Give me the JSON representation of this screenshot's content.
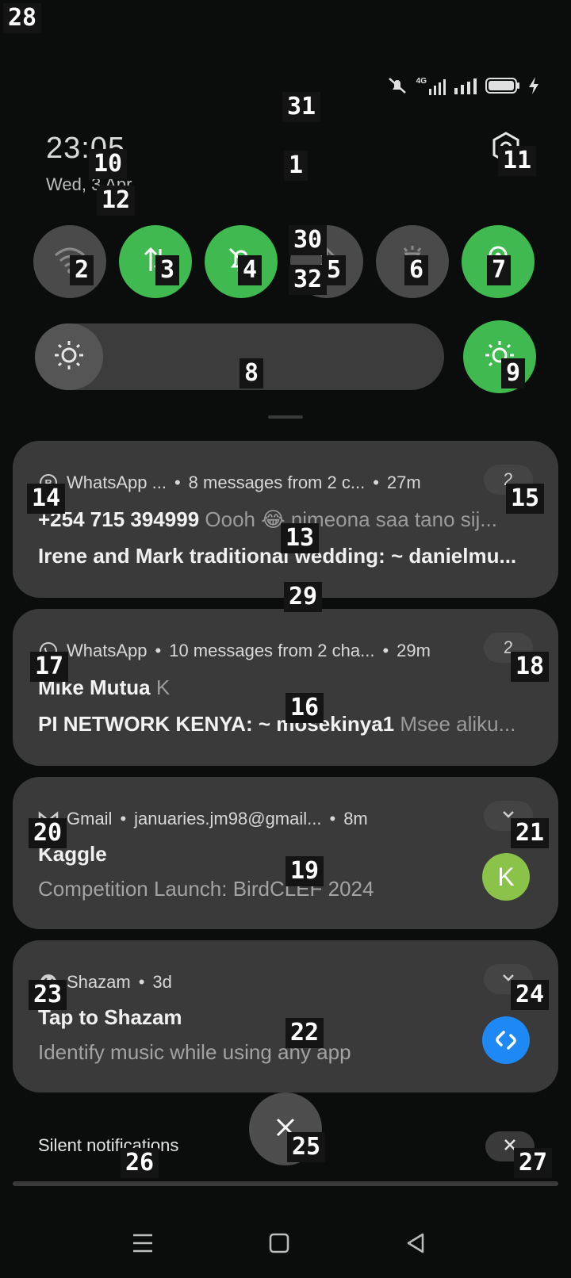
{
  "status_bar": {
    "network": "4G",
    "icons": [
      "muted-bell-icon",
      "signal-4g-icon",
      "signal-icon",
      "battery-icon",
      "charging-icon"
    ]
  },
  "header": {
    "time": "23:05",
    "date": "Wed, 3 Apr"
  },
  "quick_settings": {
    "tiles": [
      {
        "name": "wifi",
        "icon": "wifi-icon",
        "active": false
      },
      {
        "name": "mobile-data",
        "icon": "data-arrows-icon",
        "active": true
      },
      {
        "name": "silent",
        "icon": "bell-off-icon",
        "active": true
      },
      {
        "name": "bluetooth",
        "icon": "bluetooth-icon",
        "active": false
      },
      {
        "name": "flashlight",
        "icon": "flashlight-icon",
        "active": false
      },
      {
        "name": "location",
        "icon": "location-icon",
        "active": true
      }
    ],
    "brightness_level": 0.15,
    "auto_brightness": true
  },
  "notifications": [
    {
      "app": "WhatsApp ...",
      "summary": "8 messages from 2 c...",
      "time": "27m",
      "count": "2",
      "sender": "+254 715 394999",
      "preview": "Oooh 😂 nimeona saa tano sij...",
      "line2_title": "Irene and Mark traditional wedding: ~ danielmu...",
      "line2_body": ""
    },
    {
      "app": "WhatsApp",
      "summary": "10 messages from 2 cha...",
      "time": "29m",
      "count": "2",
      "sender": "Mike Mutua",
      "preview": "K",
      "line2_title": "PI NETWORK KENYA: ~ mosekinya1",
      "line2_body": "Msee aliku..."
    },
    {
      "app": "Gmail",
      "summary": "januaries.jm98@gmail...",
      "time": "8m",
      "title": "Kaggle",
      "body": "Competition Launch: BirdCLEF 2024",
      "avatar_letter": "K",
      "avatar_color": "#8bc34a"
    },
    {
      "app": "Shazam",
      "time": "3d",
      "title": "Tap to Shazam",
      "body": "Identify music while using any app",
      "avatar_color": "#1e88f5"
    }
  ],
  "silent_section": {
    "label": "Silent notifications"
  },
  "colors": {
    "accent": "#3fb950",
    "card": "#3a3a3a",
    "background": "#0b0c0c"
  },
  "labels": {
    "l1": "1",
    "l2": "2",
    "l3": "3",
    "l4": "4",
    "l5": "5",
    "l6": "6",
    "l7": "7",
    "l8": "8",
    "l9": "9",
    "l10": "10",
    "l11": "11",
    "l12": "12",
    "l13": "13",
    "l14": "14",
    "l15": "15",
    "l16": "16",
    "l17": "17",
    "l18": "18",
    "l19": "19",
    "l20": "20",
    "l21": "21",
    "l22": "22",
    "l23": "23",
    "l24": "24",
    "l25": "25",
    "l26": "26",
    "l27": "27",
    "l28": "28",
    "l29": "29",
    "l30": "30",
    "l31": "31",
    "l32": "32"
  }
}
